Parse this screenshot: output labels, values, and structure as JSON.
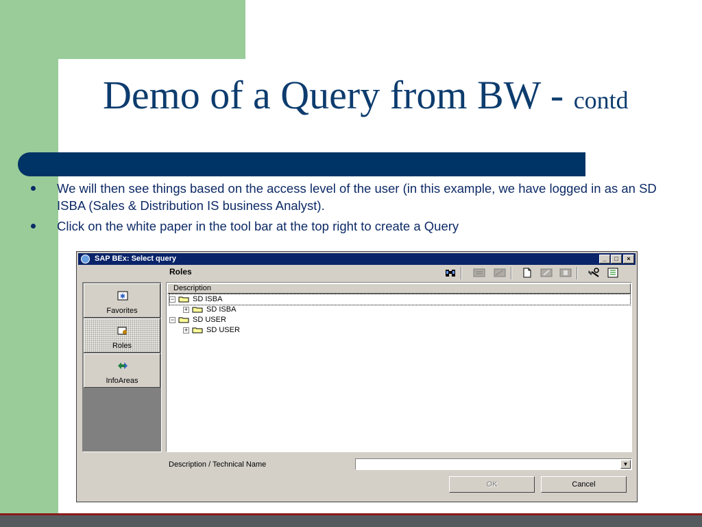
{
  "slide": {
    "title_main": "Demo of a Query from BW - ",
    "title_small": "contd",
    "bullets": [
      "We will then see things based on the access level of the user (in this example, we have logged in as an SD ISBA (Sales & Distribution IS business Analyst).",
      "Click on the white paper in the tool bar at the top right to create a Query"
    ]
  },
  "dialog": {
    "title": "SAP BEx: Select query",
    "window_buttons": [
      "_",
      "□",
      "×"
    ],
    "header": "Roles",
    "toolbar_icons": [
      "binoculars-icon",
      "info-provider-icon",
      "query-icon",
      "new-document-icon",
      "edit-icon",
      "save-icon",
      "tools-icon",
      "list-icon"
    ],
    "nav": [
      {
        "label": "Favorites",
        "icon": "favorites-icon"
      },
      {
        "label": "Roles",
        "icon": "roles-icon"
      },
      {
        "label": "InfoAreas",
        "icon": "infoareas-icon"
      }
    ],
    "column_header": "Description",
    "tree": [
      {
        "label": "SD ISBA",
        "expander": "⊟",
        "level": 0
      },
      {
        "label": "SD ISBA",
        "expander": "⊞",
        "level": 1
      },
      {
        "label": "SD USER",
        "expander": "⊟",
        "level": 0
      },
      {
        "label": "SD USER",
        "expander": "⊞",
        "level": 1
      }
    ],
    "search_label": "Description / Technical Name",
    "search_value": "",
    "ok_label": "OK",
    "cancel_label": "Cancel"
  },
  "colors": {
    "title": "#0d3c6e",
    "band": "#003366",
    "green": "#99cc99",
    "bullet_text": "#0d2a66"
  }
}
